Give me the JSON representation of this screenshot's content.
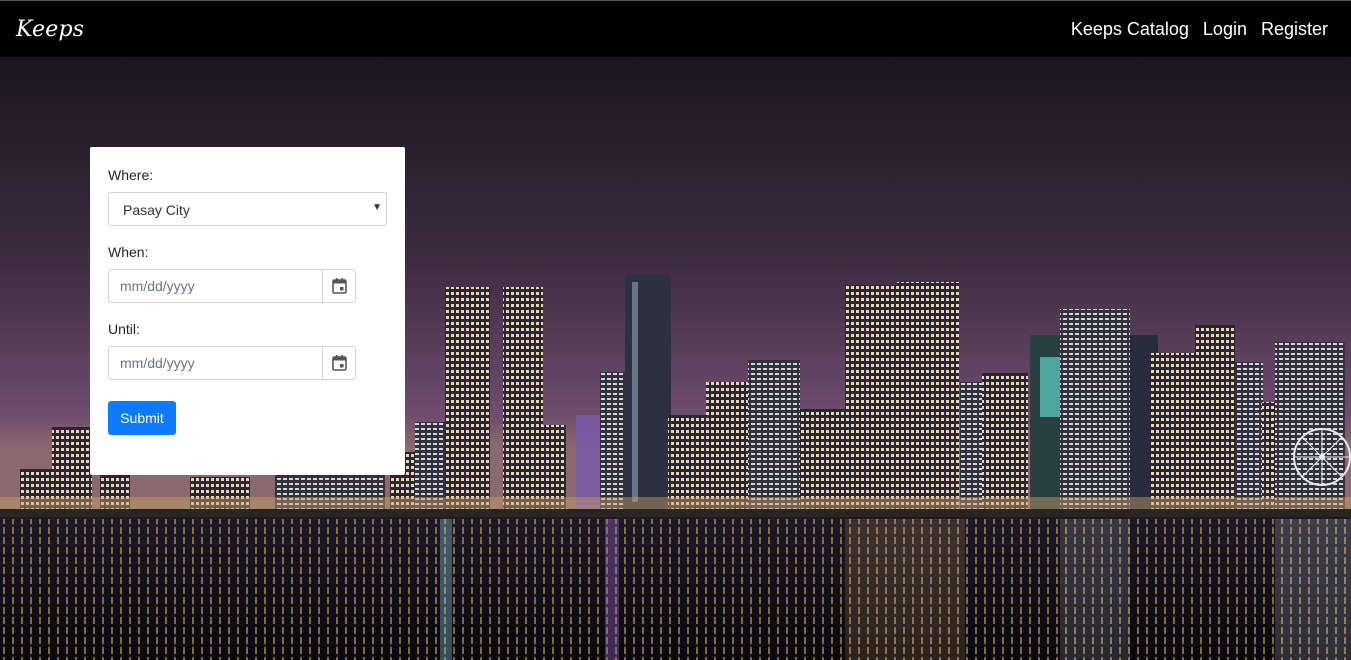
{
  "navbar": {
    "brand": "Keeps",
    "links": [
      "Keeps Catalog",
      "Login",
      "Register"
    ]
  },
  "form": {
    "where_label": "Where:",
    "where_value": "Pasay City",
    "when_label": "When:",
    "when_placeholder": "mm/dd/yyyy",
    "until_label": "Until:",
    "until_placeholder": "mm/dd/yyyy",
    "submit_label": "Submit"
  },
  "colors": {
    "navbar_bg": "#020202",
    "submit_bg": "#0d7bff",
    "sky_top": "#1b1621",
    "sky_bottom": "#6f4d6e",
    "water": "#0b0b15"
  },
  "icons": [
    "calendar-icon",
    "caret-down-icon"
  ]
}
